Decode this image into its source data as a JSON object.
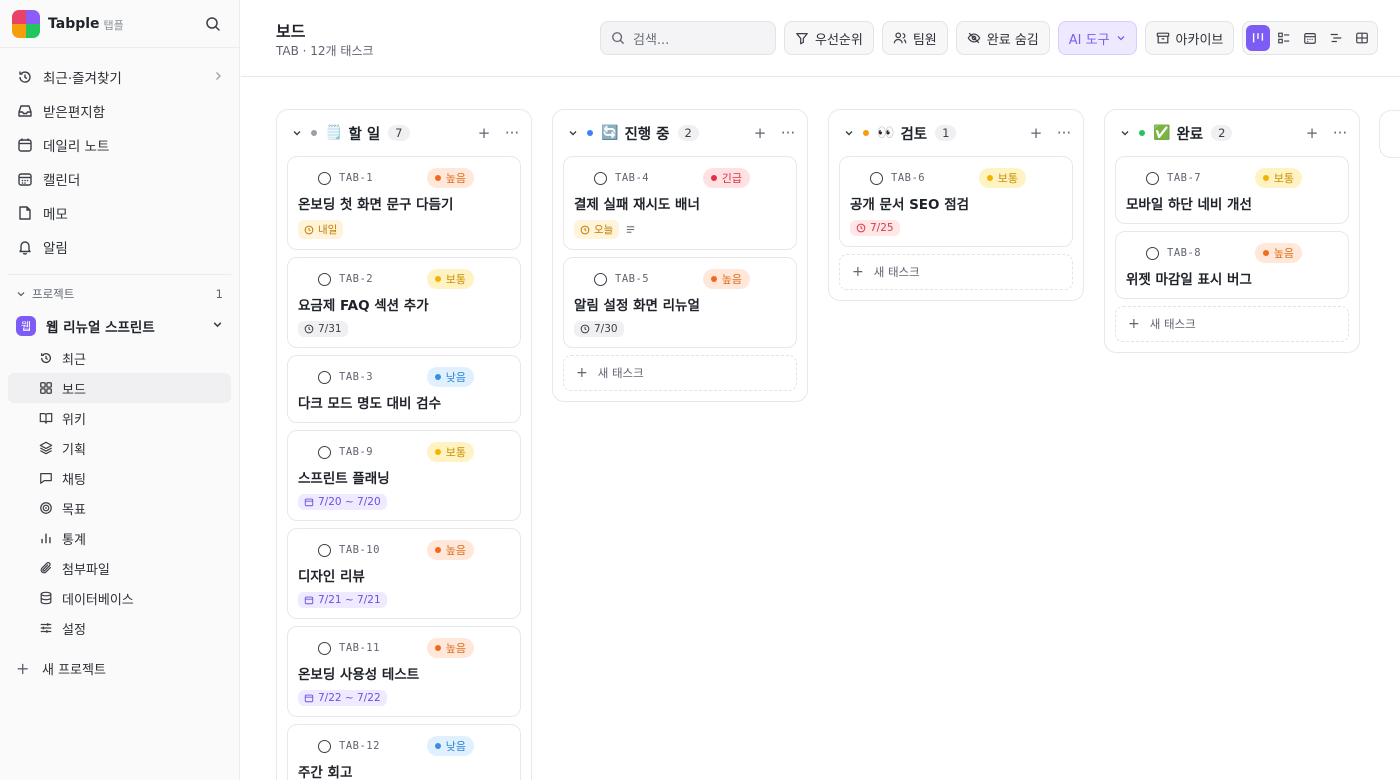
{
  "brand": {
    "name": "Tabple",
    "sub": "탭플"
  },
  "nav": [
    {
      "label": "최근·즐겨찾기",
      "icon": "history-icon"
    },
    {
      "label": "받은편지함",
      "icon": "inbox-icon"
    },
    {
      "label": "데일리 노트",
      "icon": "calendar-icon"
    },
    {
      "label": "캘린더",
      "icon": "calendar-grid-icon"
    },
    {
      "label": "메모",
      "icon": "note-icon"
    },
    {
      "label": "알림",
      "icon": "bell-icon"
    }
  ],
  "projects": {
    "heading": "프로젝트",
    "count": "1",
    "current": {
      "badge": "웹",
      "name": "웹 리뉴얼 스프린트"
    },
    "items": [
      {
        "label": "최근",
        "icon": "history-icon"
      },
      {
        "label": "보드",
        "icon": "board-icon"
      },
      {
        "label": "위키",
        "icon": "book-icon"
      },
      {
        "label": "기획",
        "icon": "layers-icon"
      },
      {
        "label": "채팅",
        "icon": "chat-icon"
      },
      {
        "label": "목표",
        "icon": "target-icon"
      },
      {
        "label": "통계",
        "icon": "bar-chart-icon"
      },
      {
        "label": "첨부파일",
        "icon": "paperclip-icon"
      },
      {
        "label": "데이터베이스",
        "icon": "database-icon"
      },
      {
        "label": "설정",
        "icon": "sliders-icon"
      }
    ],
    "new_label": "새 프로젝트"
  },
  "header": {
    "title": "보드",
    "subtitle": "TAB · 12개 태스크",
    "search_placeholder": "검색...",
    "buttons": {
      "priority": "우선순위",
      "members": "팀원",
      "hide_done": "완료 숨김",
      "ai": "AI 도구",
      "archive": "아카이브"
    }
  },
  "board": {
    "new_task_label": "새 태스크",
    "columns": [
      {
        "name": "할 일",
        "emoji": "🗒️",
        "count": "7",
        "dot": "#9aa0a8",
        "cards": [
          {
            "id": "TAB-1",
            "priority": "높음",
            "level": "high",
            "title": "온보딩 첫 화면 문구 다듬기",
            "chips": [
              {
                "text": "내일",
                "style": "amber",
                "icon": "clock"
              }
            ]
          },
          {
            "id": "TAB-2",
            "priority": "보통",
            "level": "mid",
            "title": "요금제 FAQ 섹션 추가",
            "chips": [
              {
                "text": "7/31",
                "style": "gray",
                "icon": "clock"
              }
            ]
          },
          {
            "id": "TAB-3",
            "priority": "낮음",
            "level": "low",
            "title": "다크 모드 명도 대비 검수",
            "chips": []
          },
          {
            "id": "TAB-9",
            "priority": "보통",
            "level": "mid",
            "title": "스프린트 플래닝",
            "chips": [
              {
                "text": "7/20 ~ 7/20",
                "style": "purple",
                "icon": "cal"
              }
            ]
          },
          {
            "id": "TAB-10",
            "priority": "높음",
            "level": "high",
            "title": "디자인 리뷰",
            "chips": [
              {
                "text": "7/21 ~ 7/21",
                "style": "purple",
                "icon": "cal"
              }
            ]
          },
          {
            "id": "TAB-11",
            "priority": "높음",
            "level": "high",
            "title": "온보딩 사용성 테스트",
            "chips": [
              {
                "text": "7/22 ~ 7/22",
                "style": "purple",
                "icon": "cal"
              }
            ]
          },
          {
            "id": "TAB-12",
            "priority": "낮음",
            "level": "low",
            "title": "주간 회고",
            "chips": []
          }
        ]
      },
      {
        "name": "진행 중",
        "emoji": "🔄",
        "count": "2",
        "dot": "#3b82f6",
        "cards": [
          {
            "id": "TAB-4",
            "priority": "긴급",
            "level": "urgent",
            "title": "결제 실패 재시도 배너",
            "chips": [
              {
                "text": "오늘",
                "style": "amber",
                "icon": "clock"
              }
            ],
            "desc": true
          },
          {
            "id": "TAB-5",
            "priority": "높음",
            "level": "high",
            "title": "알림 설정 화면 리뉴얼",
            "chips": [
              {
                "text": "7/30",
                "style": "gray",
                "icon": "clock"
              }
            ]
          }
        ]
      },
      {
        "name": "검토",
        "emoji": "👀",
        "count": "1",
        "dot": "#f59e0b",
        "cards": [
          {
            "id": "TAB-6",
            "priority": "보통",
            "level": "mid",
            "title": "공개 문서 SEO 점검",
            "chips": [
              {
                "text": "7/25",
                "style": "red",
                "icon": "clock"
              }
            ]
          }
        ]
      },
      {
        "name": "완료",
        "emoji": "✅",
        "count": "2",
        "dot": "#22c55e",
        "cards": [
          {
            "id": "TAB-7",
            "priority": "보통",
            "level": "mid",
            "title": "모바일 하단 네비 개선",
            "chips": []
          },
          {
            "id": "TAB-8",
            "priority": "높음",
            "level": "high",
            "title": "위젯 마감일 표시 버그",
            "chips": []
          }
        ]
      }
    ]
  }
}
